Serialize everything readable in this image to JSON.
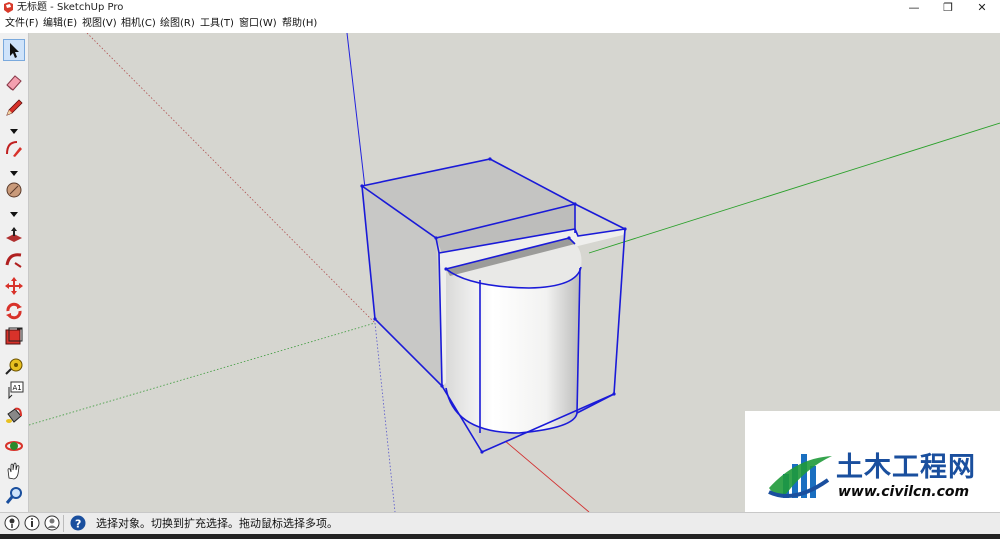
{
  "window": {
    "title": "无标题 - SketchUp Pro",
    "minimize": "—",
    "restore": "❐",
    "close": "✕"
  },
  "menu": [
    {
      "label": "文件(F)"
    },
    {
      "label": "编辑(E)"
    },
    {
      "label": "视图(V)"
    },
    {
      "label": "相机(C)"
    },
    {
      "label": "绘图(R)"
    },
    {
      "label": "工具(T)"
    },
    {
      "label": "窗口(W)"
    },
    {
      "label": "帮助(H)"
    }
  ],
  "toolbar": {
    "tools": [
      "select-tool",
      "eraser-tool",
      "pencil-line-tool",
      "arc-tool",
      "circle-tool",
      "push-pull-tool",
      "follow-me-tool",
      "move-tool",
      "rotate-tool",
      "scale-tool",
      "tape-measure-tool",
      "text-tool",
      "paint-bucket-tool",
      "orbit-tool",
      "pan-tool",
      "zoom-tool"
    ]
  },
  "axes": {
    "red": "#d23030",
    "green": "#2aa02a",
    "blue": "#2222dd"
  },
  "status": {
    "message": "选择对象。切换到扩充选择。拖动鼠标选择多项。"
  },
  "watermark": {
    "title": "土木工程网",
    "url": "www.civilcn.com"
  }
}
